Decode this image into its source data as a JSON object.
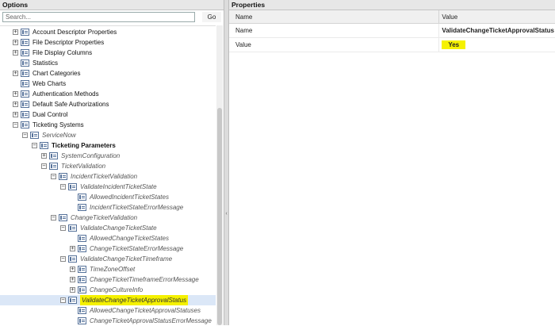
{
  "options_panel": {
    "title": "Options",
    "search": {
      "placeholder": "Search...",
      "value": ""
    },
    "go_label": "Go",
    "tree": [
      {
        "label": "Account Descriptor Properties",
        "toggle": "+",
        "style": "normal"
      },
      {
        "label": "File Descriptor Properties",
        "toggle": "+",
        "style": "normal"
      },
      {
        "label": "File Display Columns",
        "toggle": "+",
        "style": "normal"
      },
      {
        "label": "Statistics",
        "toggle": "",
        "style": "normal"
      },
      {
        "label": "Chart Categories",
        "toggle": "+",
        "style": "normal"
      },
      {
        "label": "Web Charts",
        "toggle": "",
        "style": "normal"
      },
      {
        "label": "Authentication Methods",
        "toggle": "+",
        "style": "normal"
      },
      {
        "label": "Default Safe Authorizations",
        "toggle": "+",
        "style": "normal"
      },
      {
        "label": "Dual Control",
        "toggle": "+",
        "style": "normal"
      },
      {
        "label": "Ticketing Systems",
        "toggle": "-",
        "style": "normal"
      },
      {
        "label": "ServiceNow",
        "toggle": "-",
        "style": "italic"
      },
      {
        "label": "Ticketing Parameters",
        "toggle": "-",
        "style": "bold"
      },
      {
        "label": "SystemConfiguration",
        "toggle": "+",
        "style": "italic"
      },
      {
        "label": "TicketValidation",
        "toggle": "-",
        "style": "italic"
      },
      {
        "label": "IncidentTicketValidation",
        "toggle": "-",
        "style": "italic"
      },
      {
        "label": "ValidateIncidentTicketState",
        "toggle": "-",
        "style": "italic"
      },
      {
        "label": "AllowedIncidentTicketStates",
        "toggle": "",
        "style": "italic"
      },
      {
        "label": "IncidentTicketStateErrorMessage",
        "toggle": "",
        "style": "italic"
      },
      {
        "label": "ChangeTicketValidation",
        "toggle": "-",
        "style": "italic"
      },
      {
        "label": "ValidateChangeTicketState",
        "toggle": "-",
        "style": "italic"
      },
      {
        "label": "AllowedChangeTicketStates",
        "toggle": "",
        "style": "italic"
      },
      {
        "label": "ChangeTicketStateErrorMessage",
        "toggle": "+",
        "style": "italic"
      },
      {
        "label": "ValidateChangeTicketTimeframe",
        "toggle": "-",
        "style": "italic"
      },
      {
        "label": "TimeZoneOffset",
        "toggle": "+",
        "style": "italic"
      },
      {
        "label": "ChangeTicketTimeframeErrorMessage",
        "toggle": "+",
        "style": "italic"
      },
      {
        "label": "ChangeCultureInfo",
        "toggle": "+",
        "style": "italic"
      },
      {
        "label": "ValidateChangeTicketApprovalStatus",
        "toggle": "-",
        "style": "italic-highlight"
      },
      {
        "label": "AllowedChangeTicketApprovalStatuses",
        "toggle": "",
        "style": "italic"
      },
      {
        "label": "ChangeTicketApprovalStatusErrorMessage",
        "toggle": "",
        "style": "italic"
      }
    ]
  },
  "properties_panel": {
    "title": "Properties",
    "columns": {
      "name": "Name",
      "value": "Value"
    },
    "rows": [
      {
        "name": "Name",
        "value": "ValidateChangeTicketApprovalStatus"
      },
      {
        "name": "Value",
        "value": "Yes"
      }
    ]
  },
  "colors": {
    "highlight": "#f5f100",
    "selection": "#dbe7f7",
    "header_bg": "#e7e7e7"
  },
  "splitter_icon": "collapse-arrow-icon"
}
